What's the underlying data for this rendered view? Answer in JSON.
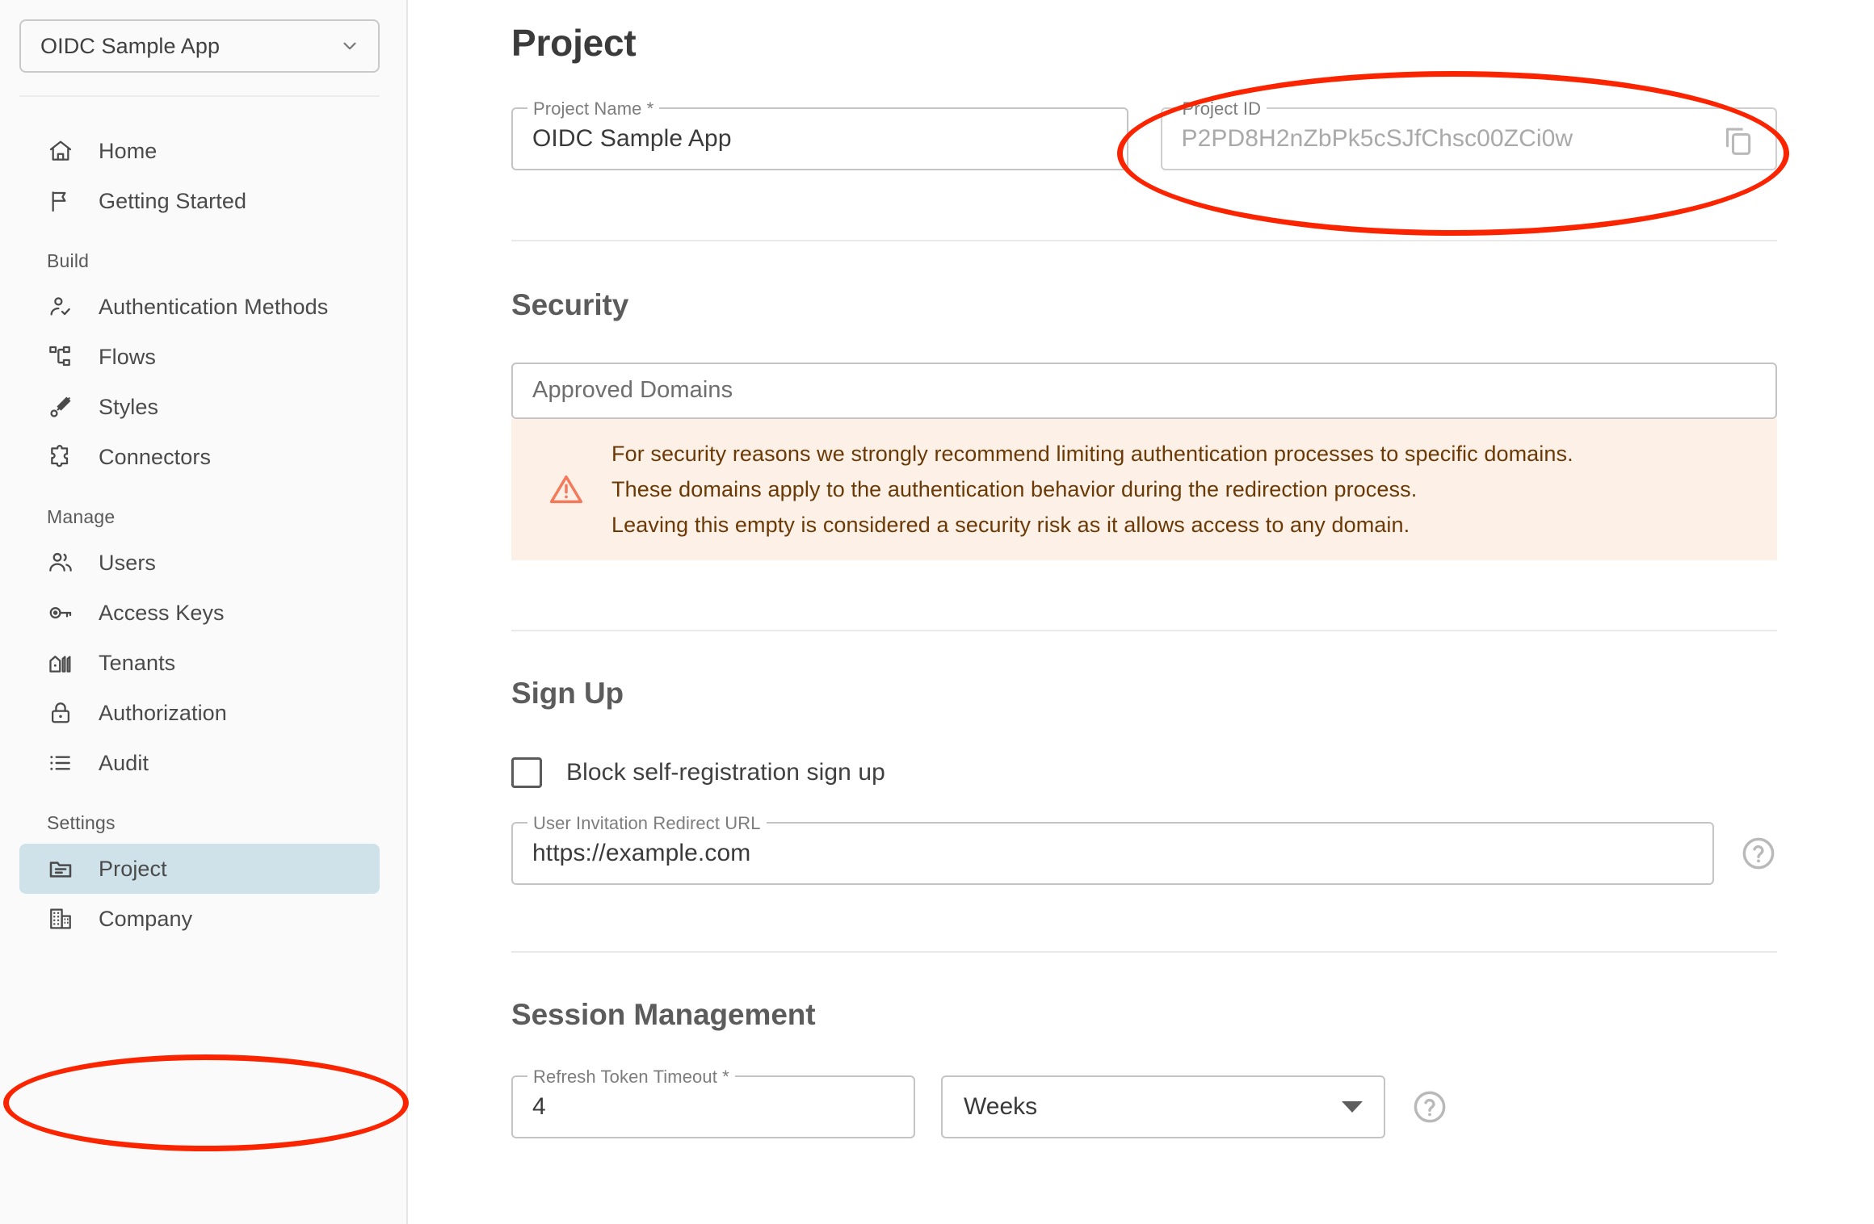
{
  "sidebar": {
    "project_switcher": {
      "label": "OIDC Sample App",
      "icon": "chevron-down-icon"
    },
    "groups": [
      {
        "label": "",
        "items": [
          {
            "label": "Home",
            "icon": "home-icon",
            "active": false
          },
          {
            "label": "Getting Started",
            "icon": "flag-icon",
            "active": false
          }
        ]
      },
      {
        "label": "Build",
        "items": [
          {
            "label": "Authentication Methods",
            "icon": "user-check-icon",
            "active": false
          },
          {
            "label": "Flows",
            "icon": "flows-icon",
            "active": false
          },
          {
            "label": "Styles",
            "icon": "brush-icon",
            "active": false
          },
          {
            "label": "Connectors",
            "icon": "puzzle-icon",
            "active": false
          }
        ]
      },
      {
        "label": "Manage",
        "items": [
          {
            "label": "Users",
            "icon": "users-icon",
            "active": false
          },
          {
            "label": "Access Keys",
            "icon": "key-icon",
            "active": false
          },
          {
            "label": "Tenants",
            "icon": "buildings-icon",
            "active": false
          },
          {
            "label": "Authorization",
            "icon": "lock-icon",
            "active": false
          },
          {
            "label": "Audit",
            "icon": "list-icon",
            "active": false
          }
        ]
      },
      {
        "label": "Settings",
        "items": [
          {
            "label": "Project",
            "icon": "folder-icon",
            "active": true
          },
          {
            "label": "Company",
            "icon": "company-icon",
            "active": false
          }
        ]
      }
    ]
  },
  "main": {
    "page_title": "Project",
    "project": {
      "name_legend": "Project Name *",
      "name_value": "OIDC Sample App",
      "id_legend": "Project ID",
      "id_value": "P2PD8H2nZbPk5cSJfChsc00ZCi0w",
      "copy_icon": "copy-icon"
    },
    "security": {
      "title": "Security",
      "approved_domains_placeholder": "Approved Domains",
      "warning_icon": "warning-triangle-icon",
      "warning_lines": [
        "For security reasons we strongly recommend limiting authentication processes to specific domains.",
        "These domains apply to the authentication behavior during the redirection process.",
        "Leaving this empty is considered a security risk as it allows access to any domain."
      ]
    },
    "signup": {
      "title": "Sign Up",
      "block_checkbox_label": "Block self-registration sign up",
      "block_checkbox_checked": false,
      "redirect_legend": "User Invitation Redirect URL",
      "redirect_value": "https://example.com",
      "help_icon": "help-circle-icon"
    },
    "session": {
      "title": "Session Management",
      "timeout_legend": "Refresh Token Timeout *",
      "timeout_value": "4",
      "unit_value": "Weeks",
      "unit_caret": "caret-down-icon",
      "help_icon": "help-circle-icon"
    }
  },
  "annotations": {
    "color": "#fa2400",
    "ellipses": [
      {
        "name": "project-id-highlight"
      },
      {
        "name": "sidebar-project-highlight"
      }
    ]
  }
}
